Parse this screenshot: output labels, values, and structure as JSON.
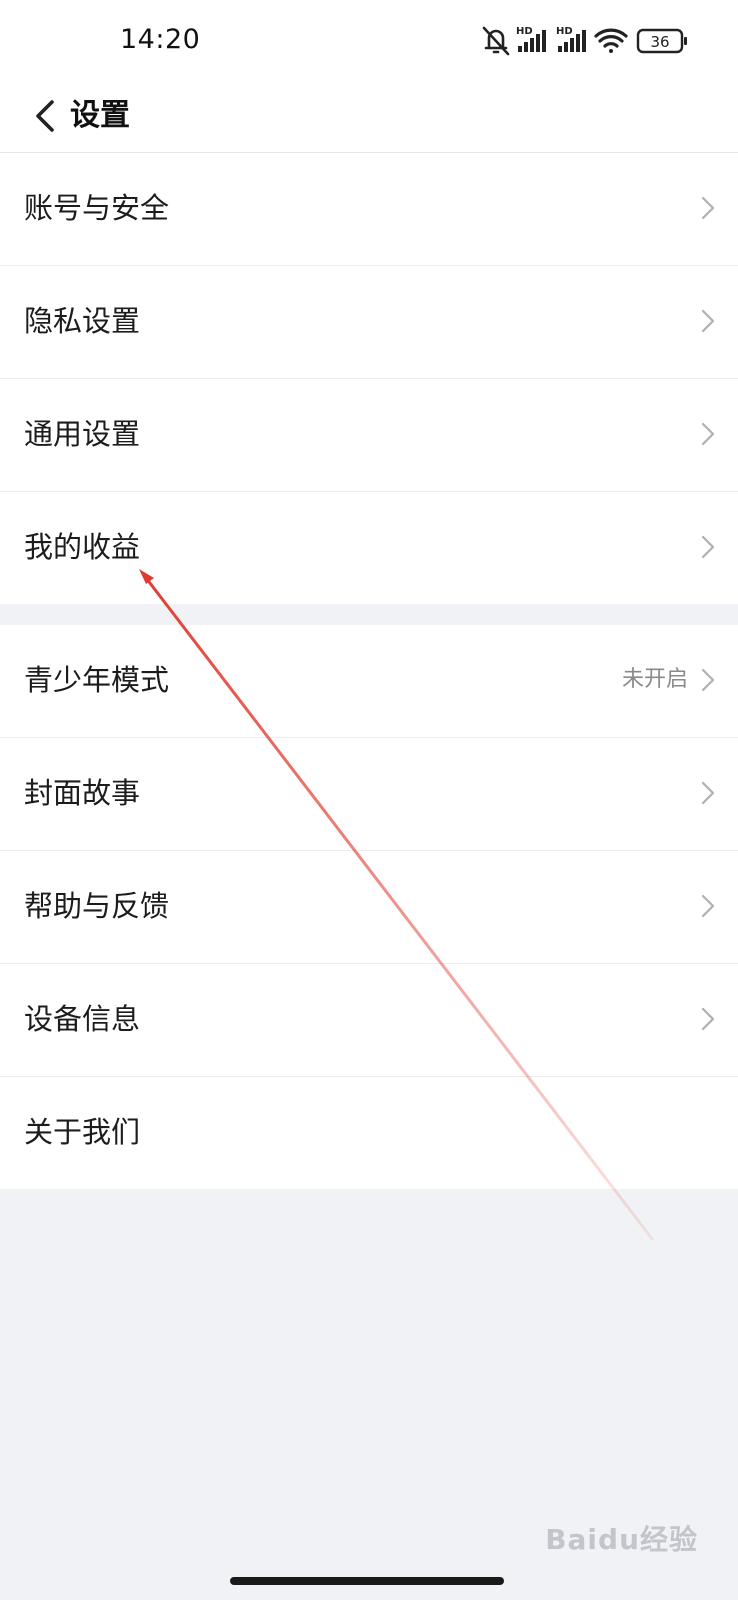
{
  "status_bar": {
    "time": "14:20",
    "battery": "36",
    "network_tags": [
      "HD",
      "HD"
    ],
    "icons": [
      "bell-muted-icon",
      "signal-icon",
      "signal-icon",
      "wifi-icon",
      "battery-icon"
    ]
  },
  "header": {
    "back_icon": "chevron-left-icon",
    "title": "设置"
  },
  "group1": [
    {
      "label": "账号与安全"
    },
    {
      "label": "隐私设置"
    },
    {
      "label": "通用设置"
    },
    {
      "label": "我的收益"
    }
  ],
  "group2": [
    {
      "label": "青少年模式",
      "value": "未开启"
    },
    {
      "label": "封面故事"
    },
    {
      "label": "帮助与反馈"
    },
    {
      "label": "设备信息"
    },
    {
      "label": "关于我们"
    }
  ],
  "watermark": "Baidu经验",
  "colors": {
    "background": "#f0f2f5",
    "row_background": "#ffffff",
    "annotation_arrow": "#e03a2f"
  }
}
